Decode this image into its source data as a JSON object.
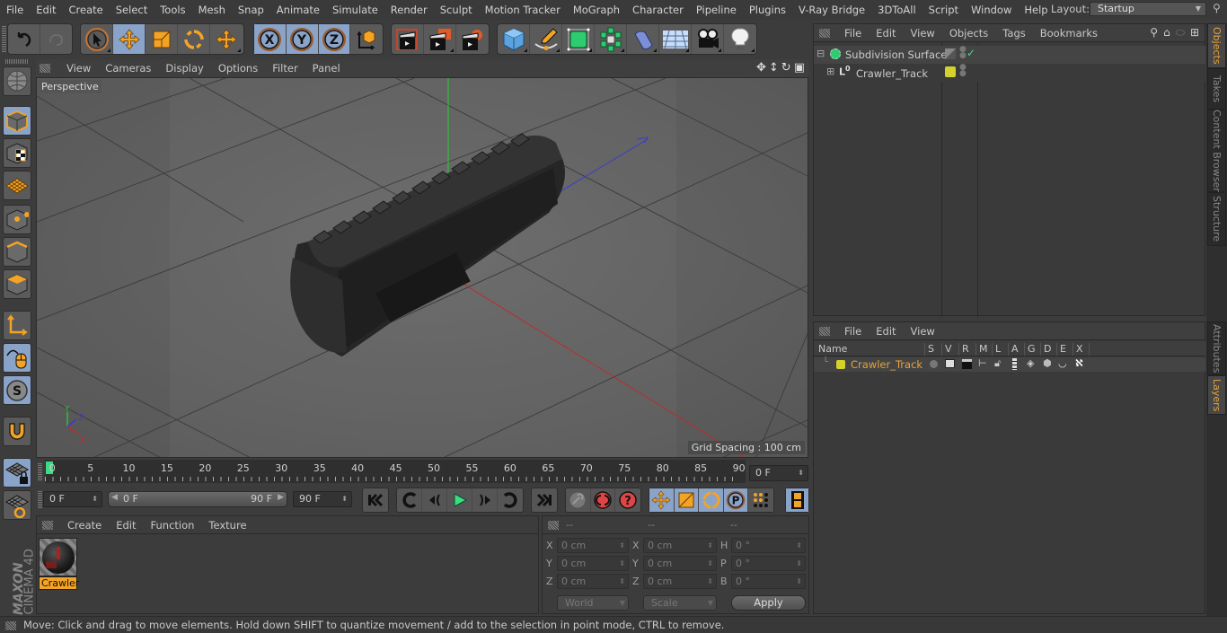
{
  "menubar": {
    "items": [
      "File",
      "Edit",
      "Create",
      "Select",
      "Tools",
      "Mesh",
      "Snap",
      "Animate",
      "Simulate",
      "Render",
      "Sculpt",
      "Motion Tracker",
      "MoGraph",
      "Character",
      "Pipeline",
      "Plugins",
      "V-Ray Bridge",
      "3DToAll",
      "Script",
      "Window",
      "Help"
    ],
    "layout_label": "Layout:",
    "layout_value": "Startup"
  },
  "toolbar": {
    "icons": [
      "undo-icon",
      "redo-icon",
      "live-selection-icon",
      "move-icon",
      "scale-icon",
      "rotate-icon",
      "recent-tools-icon",
      "x-axis-lock-icon",
      "y-axis-lock-icon",
      "z-axis-lock-icon",
      "coordinate-system-icon",
      "render-view-icon",
      "render-to-picture-viewer-icon",
      "render-settings-icon",
      "cube-primitive-icon",
      "spline-pen-icon",
      "subdivision-surface-icon",
      "cloner-icon",
      "deformer-bend-icon",
      "floor-environment-icon",
      "camera-icon",
      "light-icon"
    ]
  },
  "viewport": {
    "menu": [
      "View",
      "Cameras",
      "Display",
      "Options",
      "Filter",
      "Panel"
    ],
    "camera_label": "Perspective",
    "grid_spacing": "Grid Spacing : 100 cm",
    "axis_labels": {
      "x": "X",
      "y": "Y",
      "z": "Z"
    }
  },
  "timeline": {
    "ticks": [
      "0",
      "5",
      "10",
      "15",
      "20",
      "25",
      "30",
      "35",
      "40",
      "45",
      "50",
      "55",
      "60",
      "65",
      "70",
      "75",
      "80",
      "85",
      "90"
    ],
    "current_frame_field": "0 F",
    "start_field": "0 F",
    "range_start": "0 F",
    "range_end": "90 F",
    "end_field": "90 F",
    "current_frame": 0,
    "max_frame": 90
  },
  "materials": {
    "menu": [
      "Create",
      "Edit",
      "Function",
      "Texture"
    ],
    "items": [
      {
        "name": "Crawler"
      }
    ]
  },
  "coordinates": {
    "headers": [
      "--",
      "--",
      "--"
    ],
    "rows": [
      {
        "l1": "X",
        "v1": "0 cm",
        "l2": "X",
        "v2": "0 cm",
        "l3": "H",
        "v3": "0 °"
      },
      {
        "l1": "Y",
        "v1": "0 cm",
        "l2": "Y",
        "v2": "0 cm",
        "l3": "P",
        "v3": "0 °"
      },
      {
        "l1": "Z",
        "v1": "0 cm",
        "l2": "Z",
        "v2": "0 cm",
        "l3": "B",
        "v3": "0 °"
      }
    ],
    "mode_select": "World",
    "type_select": "Scale",
    "apply_label": "Apply"
  },
  "objects": {
    "menu": [
      "File",
      "Edit",
      "View",
      "Objects",
      "Tags",
      "Bookmarks"
    ],
    "tree": [
      {
        "name": "Subdivision Surface",
        "type": "subdivision"
      },
      {
        "name": "Crawler_Track",
        "type": "null",
        "layer_color": "#d4d12a"
      }
    ]
  },
  "layers": {
    "menu": [
      "File",
      "Edit",
      "View"
    ],
    "columns": [
      "Name",
      "S",
      "V",
      "R",
      "M",
      "L",
      "A",
      "G",
      "D",
      "E",
      "X"
    ],
    "rows": [
      {
        "name": "Crawler_Track",
        "color": "#d4d12a"
      }
    ]
  },
  "side_tabs": {
    "top": [
      "Objects",
      "Takes",
      "Content Browser",
      "Structure"
    ],
    "bottom": [
      "Attributes",
      "Layers"
    ]
  },
  "status": {
    "text": "Move: Click and drag to move elements. Hold down SHIFT to quantize movement / add to the selection in point mode, CTRL to remove."
  },
  "brand": {
    "maxon": "MAXON",
    "product": "CINEMA 4D"
  },
  "colors": {
    "accent": "#e8a33a",
    "selected_bg": "#8aa3c9",
    "layer_yellow": "#d4d12a",
    "play_green": "#3ddc84"
  }
}
